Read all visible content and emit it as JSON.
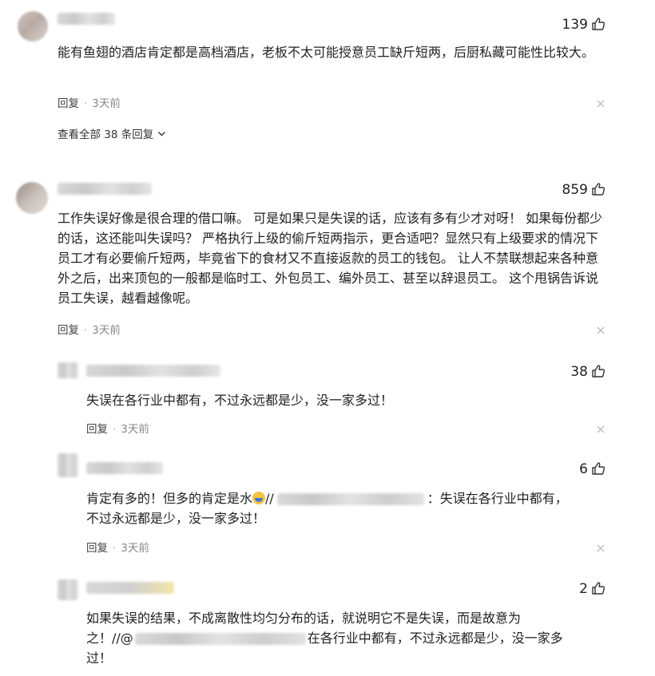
{
  "comments": [
    {
      "likes": "139",
      "text": "能有鱼翅的酒店肯定都是高档酒店，老板不太可能授意员工缺斤短两，后厨私藏可能性比较大。",
      "reply_label": "回复",
      "sep": "·",
      "time": "3天前"
    },
    {
      "likes": "859",
      "text": "工作失误好像是很合理的借口嘛。 可是如果只是失误的话，应该有多有少才对呀！ 如果每份都少的话，这还能叫失误吗？ 严格执行上级的偷斤短两指示，更合适吧？显然只有上级要求的情况下员工才有必要偷斤短两，毕竟省下的食材又不直接返款的员工的钱包。 让人不禁联想起来各种意外之后，出来顶包的一般都是临时工、外包员工、编外员工、甚至以辞退员工。 这个甩锅告诉说员工失误，越看越像呢。",
      "reply_label": "回复",
      "sep": "·",
      "time": "3天前"
    }
  ],
  "view_all": "查看全部 38 条回复",
  "replies": [
    {
      "likes": "38",
      "text": "失误在各行业中都有，不过永远都是少，没一家多过！",
      "reply_label": "回复",
      "sep": "·",
      "time": "3天前"
    },
    {
      "likes": "6",
      "text_a": "肯定有多的！但多的肯定是水",
      "text_b": "//",
      "text_c": "：失误在各行业中都有，",
      "text_d": "不过永远都是少，没一家多过！",
      "reply_label": "回复",
      "sep": "·",
      "time": "3天前"
    },
    {
      "likes": "2",
      "line1": "如果失误的结果，不成离散性均匀分布的话，就说明它不是失误，而是故意为",
      "line2a": "之！//@",
      "line2b": "在各行业中都有，不过永远都是少，没一家多",
      "line3": "过！"
    }
  ],
  "icons": {
    "like": "thumbs-up-icon",
    "close": "close-icon",
    "chevron": "chevron-down-icon"
  }
}
